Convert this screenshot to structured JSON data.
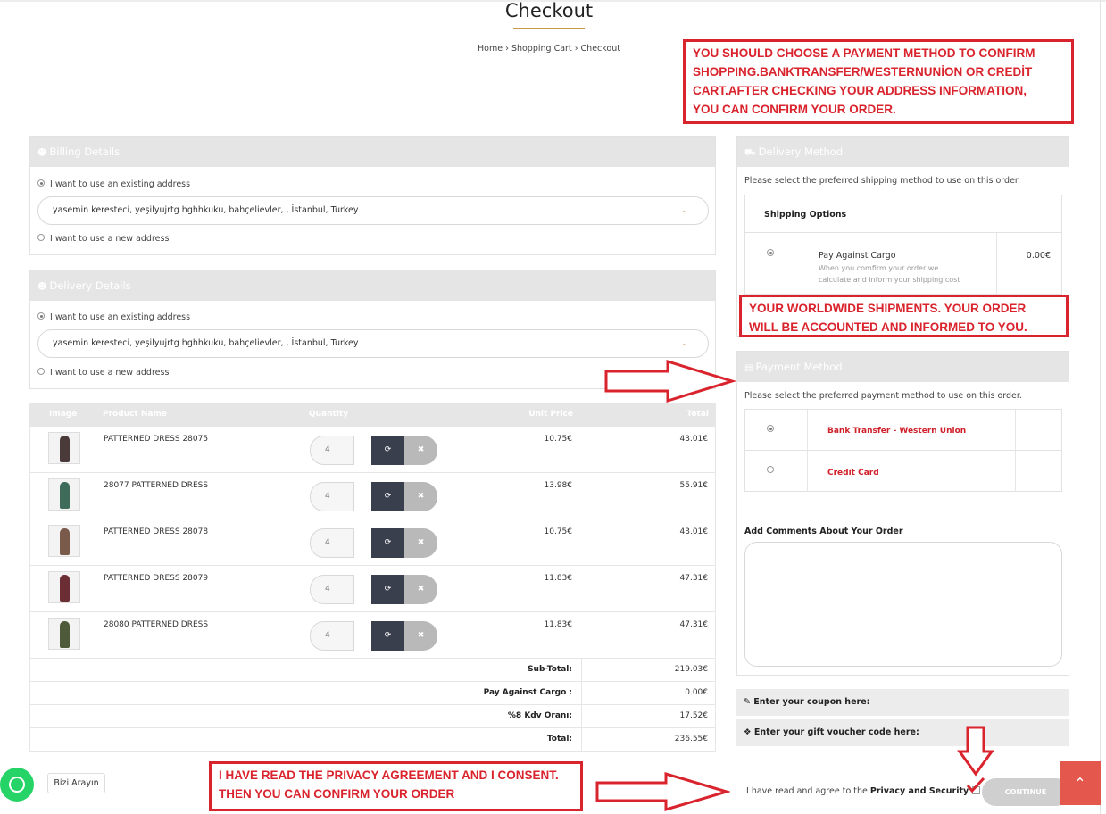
{
  "page_title": "Checkout",
  "breadcrumb": {
    "home": "Home",
    "cart": "Shopping Cart",
    "current": "Checkout",
    "sep": "›"
  },
  "billing": {
    "title": "Billing Details",
    "existing_label": "I want to use an existing address",
    "address": "yasemin keresteci, yeşilyujrtg hghhkuku, bahçelievler, , İstanbul, Turkey",
    "new_label": "I want to use a new address"
  },
  "delivery_details": {
    "title": "Delivery Details",
    "existing_label": "I want to use an existing address",
    "address": "yasemin keresteci, yeşilyujrtg hghhkuku, bahçelievler, , İstanbul, Turkey",
    "new_label": "I want to use a new address"
  },
  "cart": {
    "headers": {
      "image": "Image",
      "name": "Product Name",
      "qty": "Quantity",
      "unit": "Unit Price",
      "total": "Total"
    },
    "items": [
      {
        "name": "PATTERNED DRESS 28075",
        "qty": "4",
        "unit": "10.75€",
        "total": "43.01€",
        "color": "#4a3a3a"
      },
      {
        "name": "28077 PATTERNED DRESS",
        "qty": "4",
        "unit": "13.98€",
        "total": "55.91€",
        "color": "#3f6b5a"
      },
      {
        "name": "PATTERNED DRESS 28078",
        "qty": "4",
        "unit": "10.75€",
        "total": "43.01€",
        "color": "#7a5a4a"
      },
      {
        "name": "PATTERNED DRESS 28079",
        "qty": "4",
        "unit": "11.83€",
        "total": "47.31€",
        "color": "#6a2e34"
      },
      {
        "name": "28080 PATTERNED DRESS",
        "qty": "4",
        "unit": "11.83€",
        "total": "47.31€",
        "color": "#4f5a3a"
      }
    ],
    "totals": [
      {
        "label": "Sub-Total:",
        "value": "219.03€"
      },
      {
        "label": "Pay Against Cargo :",
        "value": "0.00€"
      },
      {
        "label": "%8 Kdv Oranı:",
        "value": "17.52€"
      },
      {
        "label": "Total:",
        "value": "236.55€"
      }
    ]
  },
  "delivery_method": {
    "title": "Delivery Method",
    "note": "Please select the preferred shipping method to use on this order.",
    "options_header": "Shipping Options",
    "option_name": "Pay Against Cargo",
    "option_desc_1": "When you comfirm your order we",
    "option_desc_2": "calculate and inform your shipping cost",
    "option_price": "0.00€"
  },
  "payment_method": {
    "title": "Payment Method",
    "note": "Please select the preferred payment method to use on this order.",
    "options": [
      "Bank Transfer - Western Union",
      "Credit Card"
    ],
    "comments_label": "Add Comments About Your Order"
  },
  "coupon": "Enter your coupon here:",
  "voucher": "Enter your gift voucher code here:",
  "agree": {
    "text": "I have read and agree to the",
    "link": "Privacy and Security"
  },
  "continue_label": "CONTINUE",
  "whatsapp_label": "Bizi Arayın",
  "annotations": {
    "top": [
      "YOU SHOULD CHOOSE A PAYMENT METHOD TO CONFIRM",
      "SHOPPING.BANKTRANSFER/WESTERNUNİON OR CREDİT",
      "CART.AFTER CHECKING YOUR ADDRESS INFORMATION,",
      "YOU CAN CONFIRM YOUR ORDER."
    ],
    "middle": [
      "YOUR WORLDWIDE SHIPMENTS. YOUR ORDER",
      "WILL BE ACCOUNTED AND INFORMED TO YOU."
    ],
    "bottom": [
      "I HAVE READ THE PRIVACY AGREEMENT AND I CONSENT.",
      "THEN YOU CAN CONFIRM YOUR ORDER"
    ]
  },
  "colors": {
    "accent": "#c79a46",
    "annotation": "#d9232d",
    "dark_button": "#3a3f4d",
    "to_top": "#e4574c"
  }
}
